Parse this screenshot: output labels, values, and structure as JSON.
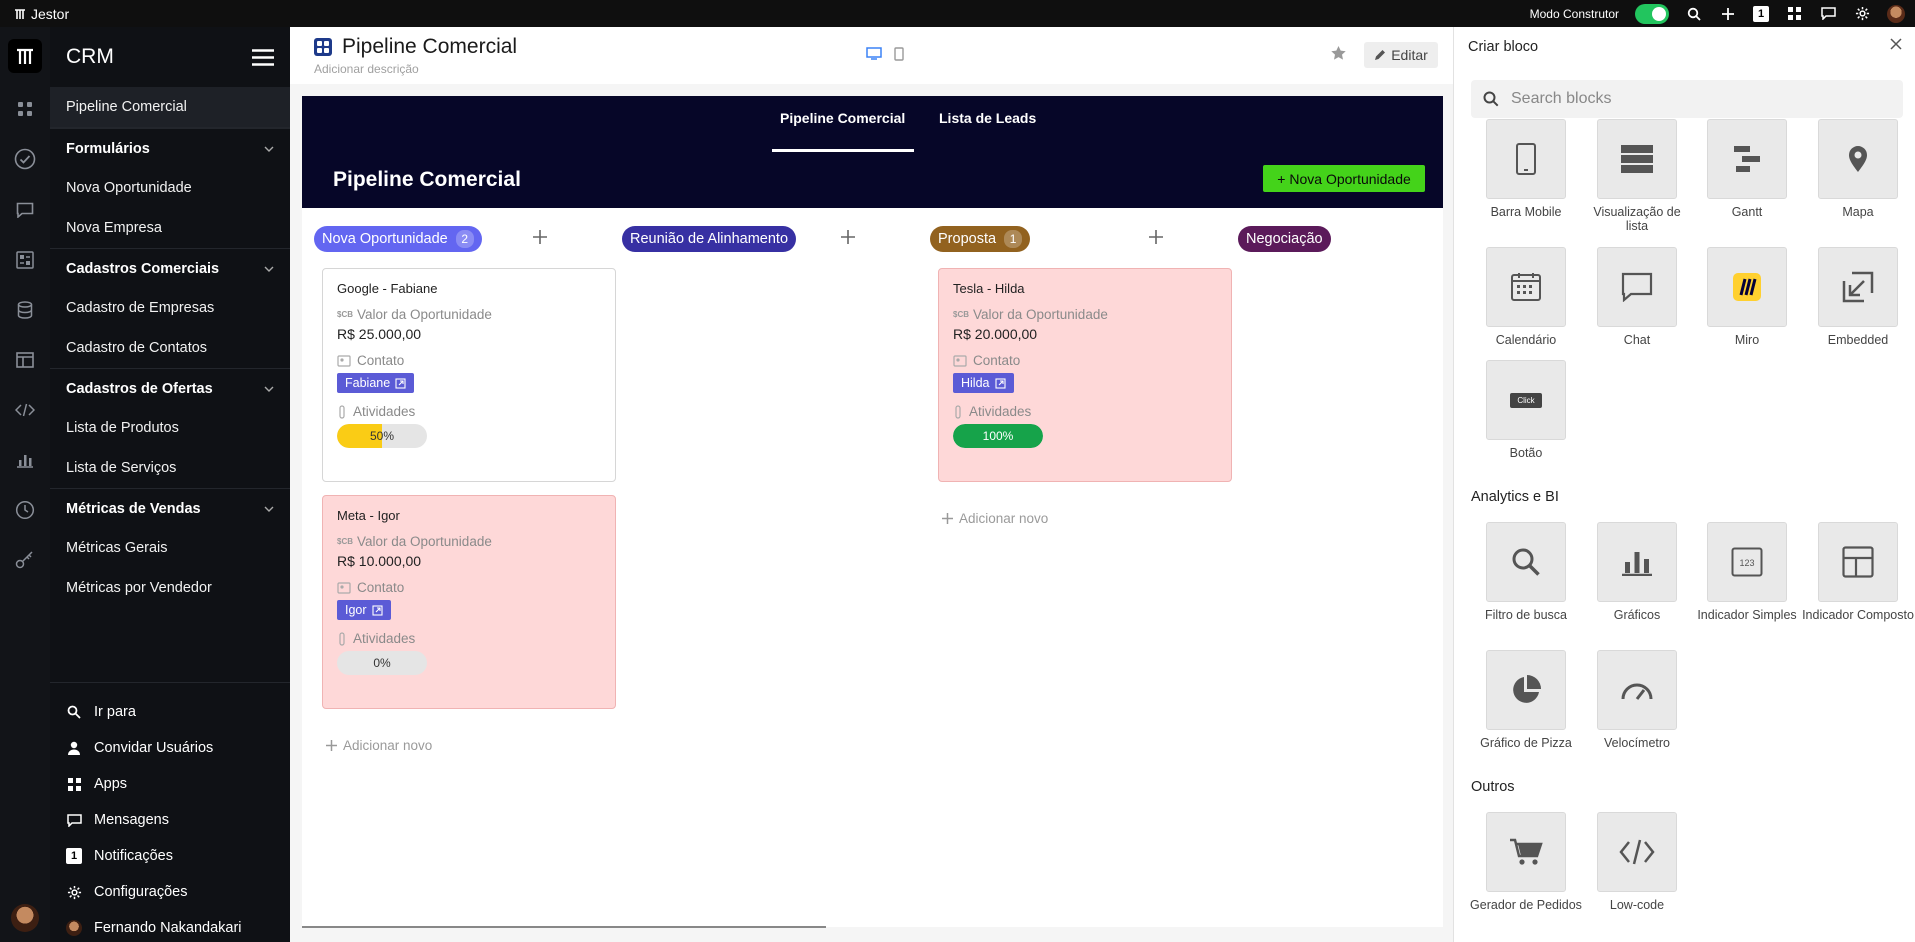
{
  "topbar": {
    "brand": "Jestor",
    "mode_label": "Modo Construtor",
    "notification_count": "1"
  },
  "sidebar": {
    "title": "CRM",
    "active_item": "Pipeline Comercial",
    "groups": [
      {
        "label": "Formulários",
        "items": [
          "Nova Oportunidade",
          "Nova Empresa"
        ]
      },
      {
        "label": "Cadastros Comerciais",
        "items": [
          "Cadastro de Empresas",
          "Cadastro de Contatos"
        ]
      },
      {
        "label": "Cadastros de Ofertas",
        "items": [
          "Lista de Produtos",
          "Lista de Serviços"
        ]
      },
      {
        "label": "Métricas de Vendas",
        "items": [
          "Métricas Gerais",
          "Métricas por Vendedor"
        ]
      }
    ],
    "bottom": {
      "goto": "Ir para",
      "invite": "Convidar Usuários",
      "apps": "Apps",
      "messages": "Mensagens",
      "notifications": "Notificações",
      "notifications_count": "1",
      "settings": "Configurações",
      "user": "Fernando Nakandakari"
    }
  },
  "header": {
    "title": "Pipeline Comercial",
    "description_placeholder": "Adicionar descrição",
    "edit_label": "Editar"
  },
  "banner": {
    "tabs": [
      "Pipeline Comercial",
      "Lista de Leads"
    ],
    "active_tab": 0,
    "title": "Pipeline Comercial",
    "new_button": "Nova Oportunidade"
  },
  "board": {
    "field_value_label": "Valor da Oportunidade",
    "field_value_icon": "$CB",
    "field_contact_label": "Contato",
    "field_activities_label": "Atividades",
    "add_new_label": "Adicionar novo",
    "columns": [
      {
        "name": "Nova Oportunidade",
        "count": "2",
        "color": "#6366f1",
        "cards": [
          {
            "title": "Google - Fabiane",
            "value": "R$ 25.000,00",
            "contact": "Fabiane",
            "progress_label": "50%",
            "progress": 0.5,
            "progress_color": "#facc15",
            "bg": "white"
          },
          {
            "title": "Meta - Igor",
            "value": "R$ 10.000,00",
            "contact": "Igor",
            "progress_label": "0%",
            "progress": 0,
            "progress_color": "#facc15",
            "bg": "red"
          }
        ]
      },
      {
        "name": "Reunião de Alinhamento",
        "count": "",
        "color": "#3730a3",
        "cards": []
      },
      {
        "name": "Proposta",
        "count": "1",
        "color": "#92621f",
        "cards": [
          {
            "title": "Tesla - Hilda",
            "value": "R$ 20.000,00",
            "contact": "Hilda",
            "progress_label": "100%",
            "progress": 1,
            "progress_color": "#16a34a",
            "bg": "red"
          }
        ]
      },
      {
        "name": "Negociação",
        "count": "",
        "color": "#5b1a5a",
        "cards": []
      }
    ]
  },
  "panel": {
    "title": "Criar bloco",
    "search_placeholder": "Search blocks",
    "click_label": "Click",
    "tiles_top": [
      {
        "label": "Barra Mobile",
        "icon": "mobile-icon"
      },
      {
        "label": "Visualização de lista",
        "icon": "list-view-icon"
      },
      {
        "label": "Gantt",
        "icon": "gantt-icon"
      },
      {
        "label": "Mapa",
        "icon": "map-pin-icon"
      },
      {
        "label": "Calendário",
        "icon": "calendar-icon"
      },
      {
        "label": "Chat",
        "icon": "chat-icon"
      },
      {
        "label": "Miro",
        "icon": "miro-icon"
      },
      {
        "label": "Embedded",
        "icon": "embed-icon"
      },
      {
        "label": "Botão",
        "icon": "button-icon"
      }
    ],
    "section_analytics": "Analytics e BI",
    "tiles_analytics": [
      {
        "label": "Filtro de busca",
        "icon": "search-icon"
      },
      {
        "label": "Gráficos",
        "icon": "bar-chart-icon"
      },
      {
        "label": "Indicador Simples",
        "icon": "number-indicator-icon"
      },
      {
        "label": "Indicador Composto",
        "icon": "layout-icon"
      },
      {
        "label": "Gráfico de Pizza",
        "icon": "pie-chart-icon"
      },
      {
        "label": "Velocímetro",
        "icon": "gauge-icon"
      }
    ],
    "indicator_text": "123",
    "section_others": "Outros",
    "tiles_others": [
      {
        "label": "Gerador de Pedidos",
        "icon": "cart-icon"
      },
      {
        "label": "Low-code",
        "icon": "code-icon"
      }
    ]
  }
}
